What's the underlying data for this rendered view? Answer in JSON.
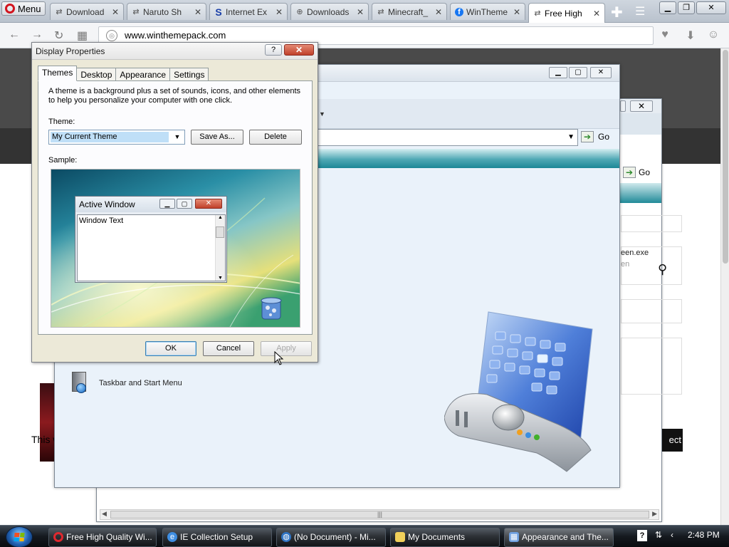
{
  "browser": {
    "menu_label": "Menu",
    "url": "www.winthemepack.com",
    "tabs": [
      {
        "title": "Download",
        "icon": "arrows-icon"
      },
      {
        "title": "Naruto Sh",
        "icon": "arrows-icon"
      },
      {
        "title": "Internet Ex",
        "icon": "s-logo-icon"
      },
      {
        "title": "Downloads",
        "icon": "download-icon"
      },
      {
        "title": "Minecraft_",
        "icon": "arrows-icon"
      },
      {
        "title": "WinTheme",
        "icon": "facebook-icon"
      },
      {
        "title": "Free High",
        "icon": "arrows-icon"
      }
    ]
  },
  "webpage": {
    "footer_text": "This website u",
    "footer_button": "ect"
  },
  "background_window": {
    "go_label": "Go",
    "exe_text": "een.exe",
    "exe_sub": "en"
  },
  "control_panel": {
    "go_label": "Go",
    "task_label": "Taskbar and Start Menu"
  },
  "display_properties": {
    "title": "Display Properties",
    "tabs": [
      "Themes",
      "Desktop",
      "Appearance",
      "Settings"
    ],
    "description": "A theme is a background plus a set of sounds, icons, and other elements to help you personalize your computer with one click.",
    "theme_label": "Theme:",
    "theme_value": "My Current Theme",
    "save_as": "Save As...",
    "delete": "Delete",
    "sample_label": "Sample:",
    "sample_window_title": "Active Window",
    "sample_window_text": "Window Text",
    "ok": "OK",
    "cancel": "Cancel",
    "apply": "Apply"
  },
  "taskbar": {
    "items": [
      {
        "label": "Free High Quality Wi...",
        "icon": "opera-icon"
      },
      {
        "label": "IE Collection Setup",
        "icon": "ie-icon"
      },
      {
        "label": "(No Document) - Mi...",
        "icon": "globe-icon"
      },
      {
        "label": "My Documents",
        "icon": "folder-icon"
      },
      {
        "label": "Appearance and The...",
        "icon": "control-panel-icon"
      }
    ],
    "clock": "2:48 PM"
  },
  "colors": {
    "accent_teal": "#1c8796",
    "close_red": "#c0412a",
    "opera_red": "#d2141e"
  }
}
